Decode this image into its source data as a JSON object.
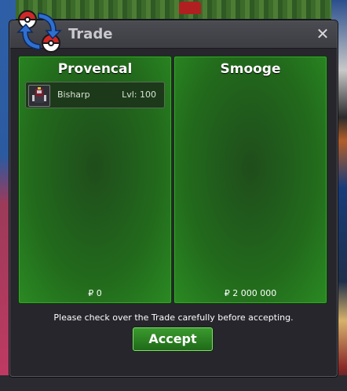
{
  "window": {
    "title": "Trade",
    "close_label": "✕"
  },
  "traders": [
    {
      "name": "Provencal",
      "items": [
        {
          "name": "Bisharp",
          "level": "Lvl: 100",
          "icon": "bisharp-sprite-icon"
        }
      ],
      "money": "₽ 0"
    },
    {
      "name": "Smooge",
      "items": [],
      "money": "₽ 2 000 000"
    }
  ],
  "notice": "Please check over the Trade carefully before accepting.",
  "accept_label": "Accept",
  "colors": {
    "panel_green": "#226a1c",
    "accept_green": "#2e8a24",
    "title_text": "#c9c9cf"
  }
}
